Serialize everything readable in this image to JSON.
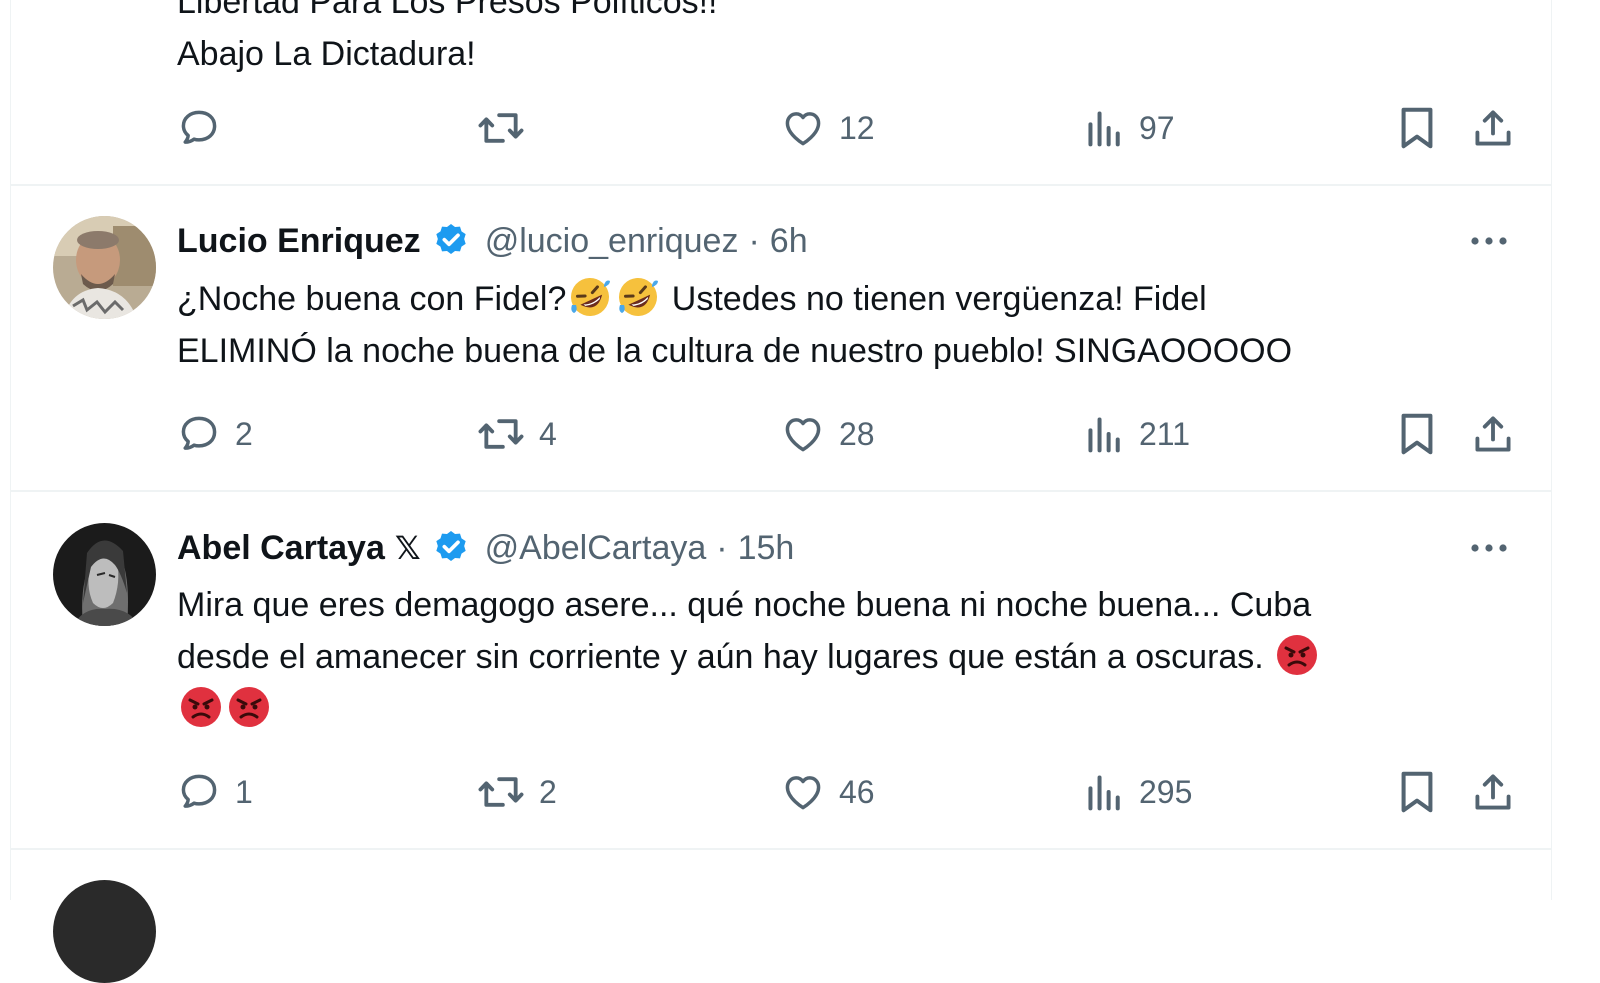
{
  "colors": {
    "text": "#0f1419",
    "secondary": "#536471",
    "verified": "#1d9bf0",
    "divider": "#eff3f4",
    "angry_emoji": "#e0313f"
  },
  "tweets": [
    {
      "text_lines": [
        "Libertad Para Los Presos Políticos!!",
        "Abajo La Dictadura!"
      ],
      "actions": {
        "replies": "",
        "retweets": "",
        "likes": "12",
        "views": "97"
      }
    },
    {
      "name": "Lucio Enriquez",
      "verified": true,
      "handle": "@lucio_enriquez",
      "separator": "·",
      "time": "6h",
      "text_lines": [
        [
          "¿Noche buena con Fidel?",
          "🤣",
          "🤣",
          " Ustedes no tienen vergüenza! Fidel"
        ],
        [
          "ELIMINÓ la noche buena de la cultura de nuestro pueblo! SINGAOOOOO"
        ]
      ],
      "actions": {
        "replies": "2",
        "retweets": "4",
        "likes": "28",
        "views": "211"
      }
    },
    {
      "name": "Abel Cartaya",
      "name_suffix": "𝕏",
      "verified": true,
      "handle": "@AbelCartaya",
      "separator": "·",
      "time": "15h",
      "text_lines": [
        [
          "Mira que eres demagogo asere... qué noche buena ni noche buena... Cuba"
        ],
        [
          "desde el amanecer sin corriente y aún hay lugares que están a oscuras. ",
          "😡"
        ],
        [
          "😡",
          "😡"
        ]
      ],
      "actions": {
        "replies": "1",
        "retweets": "2",
        "likes": "46",
        "views": "295"
      }
    }
  ],
  "icons": {
    "reply": "reply-icon",
    "retweet": "retweet-icon",
    "like": "heart-icon",
    "views": "views-icon",
    "bookmark": "bookmark-icon",
    "share": "share-icon",
    "more": "more-icon",
    "verified": "verified-badge-icon"
  }
}
